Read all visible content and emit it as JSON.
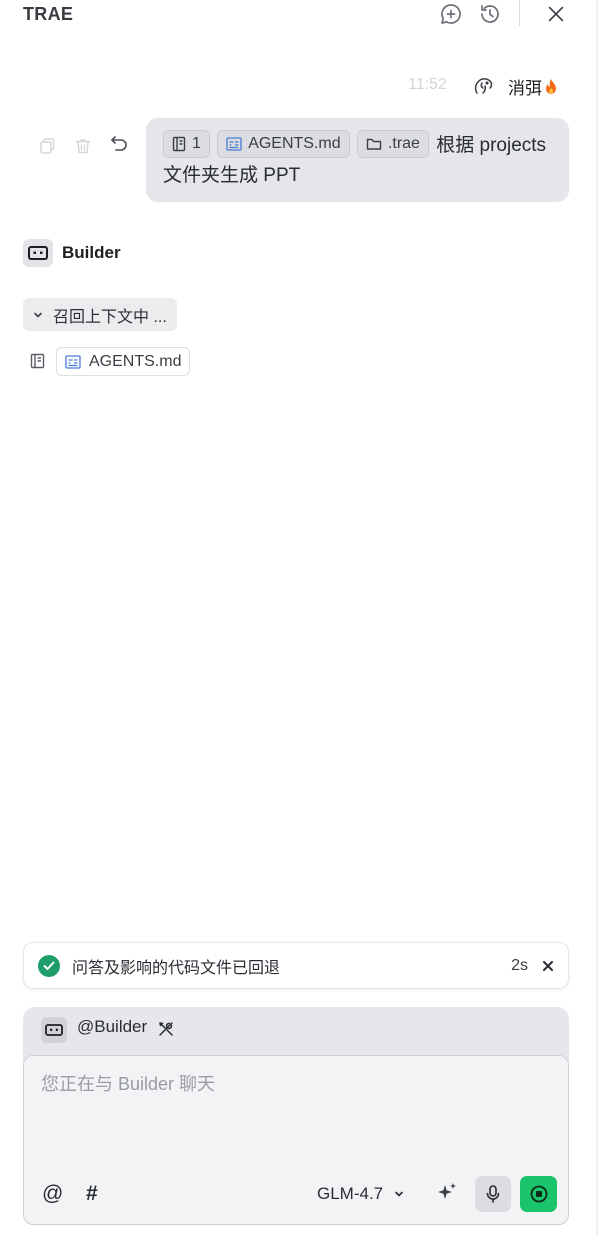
{
  "app": {
    "title": "TRAE"
  },
  "header": {
    "icons": [
      "new-chat-icon",
      "history-icon",
      "close-icon"
    ]
  },
  "user_message": {
    "time": "11:52",
    "username": "消弭",
    "badge_icon": "fire-icon",
    "chips": [
      {
        "icon": "doc-list-icon",
        "label": "1"
      },
      {
        "icon": "markdown-file-icon",
        "label": "AGENTS.md"
      },
      {
        "icon": "folder-icon",
        "label": ".trae"
      }
    ],
    "text_line1": "根据 projects",
    "text_line2": "文件夹生成 PPT",
    "actions": [
      "copy-icon",
      "delete-icon",
      "undo-icon"
    ]
  },
  "assistant": {
    "name": "Builder",
    "recall_label": "召回上下文中 ...",
    "context_file": "AGENTS.md"
  },
  "toast": {
    "message": "问答及影响的代码文件已回退",
    "timer": "2s"
  },
  "composer": {
    "agent_mention": "@Builder",
    "placeholder": "您正在与 Builder 聊天",
    "model": "GLM-4.7",
    "at_symbol": "@",
    "hash_symbol": "#"
  },
  "colors": {
    "accent_green": "#19c46a",
    "check_green": "#1f9d6b",
    "bubble_bg": "#e5e6ea",
    "file_icon_blue": "#4a7bd8",
    "fire": "#f26b1d"
  }
}
